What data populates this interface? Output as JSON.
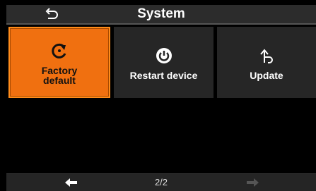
{
  "header": {
    "title": "System",
    "back_icon": "back-arrow-icon"
  },
  "tiles": [
    {
      "label": "Factory\ndefault",
      "icon": "reset-icon",
      "selected": true
    },
    {
      "label": "Restart device",
      "icon": "power-icon",
      "selected": false
    },
    {
      "label": "Update",
      "icon": "update-arrow-icon",
      "selected": false
    }
  ],
  "footer": {
    "page": "2/2",
    "prev_icon": "left-arrow-icon",
    "next_icon": "right-arrow-icon",
    "next_enabled": false
  },
  "colors": {
    "accent": "#f07010",
    "tile_bg": "#262626",
    "header_bg": "#2c2c2c"
  }
}
